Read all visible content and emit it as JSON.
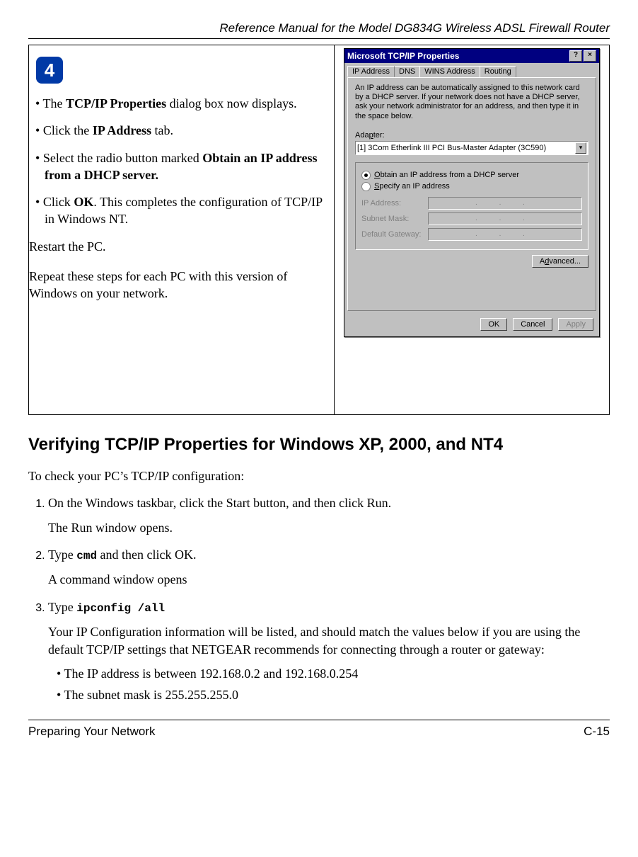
{
  "header": {
    "title": "Reference Manual for the Model DG834G Wireless ADSL Firewall Router"
  },
  "step": {
    "number": "4",
    "bullets": {
      "b1_pre": "The ",
      "b1_bold": "TCP/IP Properties",
      "b1_post": " dialog box now displays.",
      "b2_pre": "Click the ",
      "b2_bold": "IP Address",
      "b2_post": " tab.",
      "b3_pre": "Select the radio button marked ",
      "b3_bold": "Obtain an IP address from a DHCP server.",
      "b4_pre": "Click ",
      "b4_bold": "OK",
      "b4_post": ".  This completes the configuration of TCP/IP in Windows NT."
    },
    "para1": "Restart the PC.",
    "para2": "Repeat these steps for each PC with this version of Windows on your network."
  },
  "dialog": {
    "title": "Microsoft TCP/IP Properties",
    "help_btn": "?",
    "close_btn": "×",
    "tabs": {
      "t1": "IP Address",
      "t2": "DNS",
      "t3": "WINS Address",
      "t4": "Routing"
    },
    "info": "An IP address can be automatically assigned to this network card by a DHCP server. If your network does not have a DHCP server, ask your network administrator for an address, and then type it in the space below.",
    "adapter_label_pre": "Ada",
    "adapter_label_hot": "p",
    "adapter_label_post": "ter:",
    "adapter_value": "[1] 3Com Etherlink III PCI Bus-Master Adapter (3C590)",
    "radio1_hot": "O",
    "radio1_rest": "btain an IP address from a DHCP server",
    "radio2_hot": "S",
    "radio2_rest": "pecify an IP address",
    "ip_label": "IP Address:",
    "mask_label": "Subnet Mask:",
    "gw_label": "Default Gateway:",
    "dots": ".  .  .",
    "advanced_pre": "A",
    "advanced_hot": "d",
    "advanced_post": "vanced...",
    "ok": "OK",
    "cancel": "Cancel",
    "apply": "Apply"
  },
  "section": {
    "heading": "Verifying TCP/IP Properties for Windows XP, 2000, and NT4",
    "intro": "To check your PC’s TCP/IP configuration:",
    "item1": "On the Windows taskbar, click the Start button, and then click Run.",
    "item1_sub": "The Run window opens.",
    "item2_pre": "Type ",
    "item2_code": "cmd",
    "item2_post": " and then click OK.",
    "item2_sub": "A command window opens",
    "item3_pre": "Type ",
    "item3_code": "ipconfig /all",
    "item3_sub": "Your IP Configuration information will be listed, and should match the values below if you are using the default TCP/IP settings that NETGEAR recommends for connecting through a router or gateway:",
    "item3_b1": "The IP address is between 192.168.0.2 and 192.168.0.254",
    "item3_b2": "The subnet mask is 255.255.255.0"
  },
  "footer": {
    "left": "Preparing Your Network",
    "right": "C-15"
  }
}
